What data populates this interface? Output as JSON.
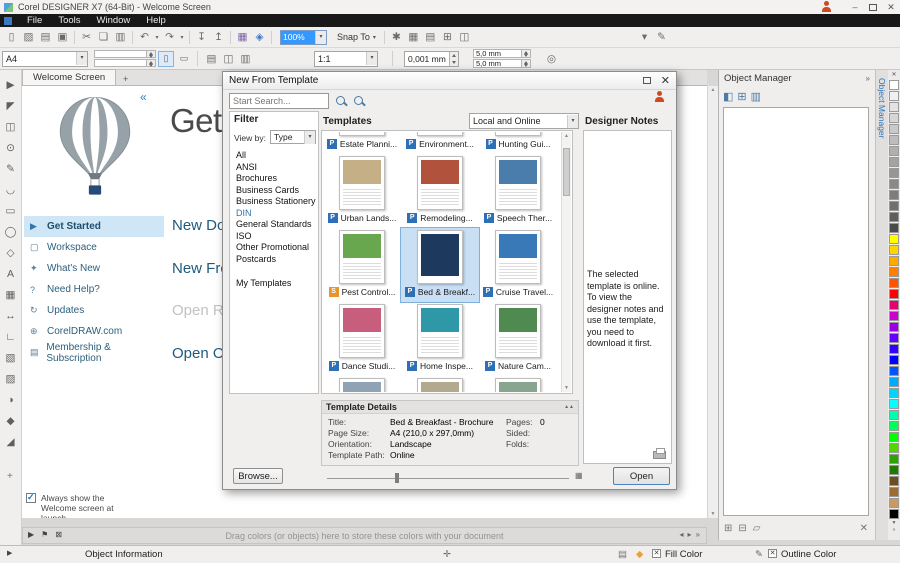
{
  "window": {
    "title": "Corel DESIGNER X7 (64-Bit) - Welcome Screen"
  },
  "icons": {
    "minimize": "–",
    "close": "✕",
    "dropdown": "▾",
    "scroll_up": "▲",
    "scroll_down": "▼",
    "chevrons_right": "»",
    "collapse_left": "«",
    "plus": "+",
    "collapse_up": "▲▲",
    "pal_down": "▼",
    "pal_more": "»"
  },
  "menubar": {
    "items": [
      {
        "label": "File"
      },
      {
        "label": "Tools"
      },
      {
        "label": "Window"
      },
      {
        "label": "Help"
      }
    ]
  },
  "toolbar": {
    "zoom_value": "100%",
    "snap_label": "Snap To",
    "left_icons": [
      {
        "name": "new-document-icon",
        "glyph": "▯"
      },
      {
        "name": "open-icon",
        "glyph": "▨"
      },
      {
        "name": "save-icon",
        "glyph": "▤"
      },
      {
        "name": "print-icon",
        "glyph": "▣"
      },
      {
        "sep": true,
        "interactable": "false"
      },
      {
        "name": "cut-icon",
        "glyph": "✂"
      },
      {
        "name": "copy-icon",
        "glyph": "❏"
      },
      {
        "name": "paste-icon",
        "glyph": "▥"
      },
      {
        "sep": true,
        "interactable": "false"
      },
      {
        "name": "undo-icon",
        "glyph": "↶"
      },
      {
        "name": "undo-dropdown-icon",
        "glyph": "▾",
        "small": true
      },
      {
        "name": "redo-icon",
        "glyph": "↷"
      },
      {
        "name": "redo-dropdown-icon",
        "glyph": "▾",
        "small": true
      },
      {
        "sep": true,
        "interactable": "false"
      },
      {
        "name": "import-icon",
        "glyph": "↧"
      },
      {
        "name": "export-icon",
        "glyph": "↥"
      },
      {
        "sep": true,
        "interactable": "false"
      },
      {
        "name": "application-launcher-icon",
        "glyph": "▦",
        "color": "#7b5ea7"
      },
      {
        "name": "welcome-screen-icon",
        "glyph": "◈",
        "color": "#3b78c3"
      },
      {
        "sep": true,
        "interactable": "false"
      }
    ],
    "right_icons": [
      {
        "sep": true,
        "interactable": "false"
      },
      {
        "name": "options-icon",
        "glyph": "✱"
      },
      {
        "name": "snap-settings-icon",
        "glyph": "▦"
      },
      {
        "name": "guidelines-icon",
        "glyph": "▤"
      },
      {
        "name": "grid-icon",
        "glyph": "⊞"
      },
      {
        "name": "rulers-icon",
        "glyph": "◫"
      }
    ],
    "far_icons": [
      {
        "name": "toolbar-overflow-icon",
        "glyph": "▾"
      },
      {
        "name": "customize-icon",
        "glyph": "✎"
      }
    ]
  },
  "propbar": {
    "page_size": "A4",
    "portrait": "▯",
    "landscape": "▭",
    "ratio": "1:1",
    "nudge": "0,001 mm",
    "dup_x": "5,0 mm",
    "dup_y": "5,0 mm",
    "icons": [
      {
        "name": "units-icon",
        "glyph": "▤"
      },
      {
        "name": "page-settings-icon",
        "glyph": "◫"
      },
      {
        "name": "drawing-units-icon",
        "glyph": "▥"
      }
    ],
    "trailing_icon": "◎"
  },
  "tabbar": {
    "welcome_tab": "Welcome Screen"
  },
  "toolbox": {
    "tools": [
      {
        "name": "pick-tool",
        "glyph": "▶"
      },
      {
        "name": "shape-tool",
        "glyph": "◤"
      },
      {
        "name": "crop-tool",
        "glyph": "◫"
      },
      {
        "name": "zoom-tool",
        "glyph": "⊙"
      },
      {
        "name": "freehand-tool",
        "glyph": "✎"
      },
      {
        "name": "curve-tool",
        "glyph": "◡"
      },
      {
        "name": "rectangle-tool",
        "glyph": "▭"
      },
      {
        "name": "ellipse-tool",
        "glyph": "◯"
      },
      {
        "name": "polygon-tool",
        "glyph": "◇"
      },
      {
        "name": "text-tool",
        "glyph": "A"
      },
      {
        "name": "table-tool",
        "glyph": "▦"
      },
      {
        "name": "dimension-tool",
        "glyph": "↔"
      },
      {
        "name": "connector-tool",
        "glyph": "∟"
      },
      {
        "name": "drop-shadow-tool",
        "glyph": "▧"
      },
      {
        "name": "transparency-tool",
        "glyph": "▨"
      },
      {
        "name": "eyedropper-tool",
        "glyph": "◑"
      },
      {
        "name": "outline-tool",
        "glyph": "◆"
      },
      {
        "name": "fill-tool",
        "glyph": "◢"
      }
    ],
    "expand": "+"
  },
  "welcome": {
    "sidebar": [
      {
        "label": "Get Started",
        "glyph": "▶",
        "icon_name": "get-started-icon",
        "icon_color": "#2e74b5",
        "active": true
      },
      {
        "label": "Workspace",
        "glyph": "▢",
        "icon_name": "workspace-icon",
        "icon_color": "#5b7e95"
      },
      {
        "label": "What's New",
        "glyph": "✦",
        "icon_name": "whats-new-icon",
        "icon_color": "#5b7e95"
      },
      {
        "label": "Need Help?",
        "glyph": "?",
        "icon_name": "need-help-icon",
        "icon_color": "#5b7e95"
      },
      {
        "label": "Updates",
        "glyph": "↻",
        "icon_name": "updates-icon",
        "icon_color": "#5b7e95"
      },
      {
        "label": "CorelDRAW.com",
        "glyph": "⊕",
        "icon_name": "coreldraw-com-icon",
        "icon_color": "#5b7e95"
      },
      {
        "label": "Membership & Subscription",
        "glyph": "▤",
        "icon_name": "membership-icon",
        "icon_color": "#5b7e95"
      }
    ],
    "headings": {
      "main": "Get",
      "new_document": "New Doc",
      "new_from_template": "New Fro",
      "open_recent": "Open Rec",
      "open_other": "Open Oth"
    },
    "launch_checkbox": {
      "checked": true,
      "label": "Always show the Welcome screen at launch."
    }
  },
  "dialog": {
    "title": "New From Template",
    "search": {
      "placeholder": "Start Search..."
    },
    "filter": {
      "header": "Filter",
      "view_by_label": "View by:",
      "view_by_value": "Type",
      "items": [
        {
          "label": "All"
        },
        {
          "label": "ANSI"
        },
        {
          "label": "Brochures"
        },
        {
          "label": "Business Cards"
        },
        {
          "label": "Business Stationery"
        },
        {
          "label": "DIN",
          "highlight": true
        },
        {
          "label": "General Standards"
        },
        {
          "label": "ISO"
        },
        {
          "label": "Other Promotional"
        },
        {
          "label": "Postcards"
        }
      ],
      "my_templates_label": "My Templates"
    },
    "templates": {
      "header": "Templates",
      "source_value": "Local and Online",
      "items": [
        {
          "name": "Estate Planni...",
          "badge": "P",
          "badge_color": "#2f6fb5",
          "accent": "#a8b0b8"
        },
        {
          "name": "Environment...",
          "badge": "P",
          "badge_color": "#2f6fb5",
          "accent": "#6f9f5f"
        },
        {
          "name": "Hunting Gui...",
          "badge": "P",
          "badge_color": "#2f6fb5",
          "accent": "#7d6f52"
        },
        {
          "name": "Urban Lands...",
          "badge": "P",
          "badge_color": "#2f6fb5",
          "accent": "#c4af86"
        },
        {
          "name": "Remodeling...",
          "badge": "P",
          "badge_color": "#2f6fb5",
          "accent": "#b0523c"
        },
        {
          "name": "Speech Ther...",
          "badge": "P",
          "badge_color": "#2f6fb5",
          "accent": "#4a7dab"
        },
        {
          "name": "Pest Control...",
          "badge": "S",
          "badge_color": "#e6952f",
          "accent": "#69a74e"
        },
        {
          "name": "Bed & Breakf...",
          "badge": "P",
          "badge_color": "#2f6fb5",
          "accent": "#1d3a5e",
          "selected": true
        },
        {
          "name": "Cruise Travel...",
          "badge": "P",
          "badge_color": "#2f6fb5",
          "accent": "#3a79b8"
        },
        {
          "name": "Dance Studi...",
          "badge": "P",
          "badge_color": "#2f6fb5",
          "accent": "#c75e7e"
        },
        {
          "name": "Home Inspe...",
          "badge": "P",
          "badge_color": "#2f6fb5",
          "accent": "#2f98a8"
        },
        {
          "name": "Nature Cam...",
          "badge": "P",
          "badge_color": "#2f6fb5",
          "accent": "#4f8a50"
        },
        {
          "name": "",
          "badge": "",
          "accent": "#8fa3b5"
        },
        {
          "name": "",
          "badge": "",
          "accent": "#b3a98f"
        },
        {
          "name": "",
          "badge": "",
          "accent": "#88a58f"
        }
      ]
    },
    "designer_notes": {
      "header": "Designer Notes",
      "text": "The selected template is online. To view the designer notes and use the template, you need to download it first."
    },
    "details": {
      "header": "Template Details",
      "fields": [
        {
          "label": "Title:",
          "value": "Bed & Breakfast - Brochure"
        },
        {
          "label": "Page Size:",
          "value": "A4 (210,0 x 297,0mm)"
        },
        {
          "label": "Orientation:",
          "value": "Landscape"
        },
        {
          "label": "Template Path:",
          "value": "Online"
        }
      ],
      "fields_right": [
        {
          "label": "Pages:",
          "value": "0"
        },
        {
          "label": "Sided:",
          "value": ""
        },
        {
          "label": "Folds:",
          "value": ""
        }
      ]
    },
    "browse_button": "Browse...",
    "open_button": "Open"
  },
  "docker": {
    "title": "Object Manager",
    "tab_label": "Object Manager",
    "toolbar_icons": [
      {
        "name": "object-properties-icon",
        "glyph": "◧"
      },
      {
        "name": "edit-across-layers-icon",
        "glyph": "⊞"
      },
      {
        "name": "layer-manager-view-icon",
        "glyph": "▥"
      }
    ],
    "bottom_icons": [
      {
        "name": "new-layer-icon",
        "glyph": "⊞"
      },
      {
        "name": "new-master-layer-icon",
        "glyph": "⊟"
      },
      {
        "name": "new-object-icon",
        "glyph": "▱"
      }
    ],
    "delete_icon": "✕"
  },
  "palette": {
    "colors": [
      "#ffffff",
      "#f0f0f0",
      "#e3e3e3",
      "#d6d6d6",
      "#c9c9c9",
      "#bdbdbd",
      "#b0b0b0",
      "#a3a3a3",
      "#969696",
      "#898989",
      "#7d7d7d",
      "#707070",
      "#5e5e5e",
      "#4a4a4a",
      "#ffff00",
      "#ffd400",
      "#ffaa00",
      "#ff7f00",
      "#ff5500",
      "#ff0000",
      "#e60073",
      "#cc00cc",
      "#9900e6",
      "#6600ff",
      "#3300ff",
      "#0000ff",
      "#0055ff",
      "#00aaff",
      "#00d4ff",
      "#00ffff",
      "#00ffaa",
      "#00ff55",
      "#00ff00",
      "#55d400",
      "#2da300",
      "#1e7a00",
      "#6b4f1e",
      "#9b6b32",
      "#c89a64",
      "#000000"
    ]
  },
  "hintbar": {
    "text": "Drag colors (or objects) here to store these colors with your document",
    "left_icons": [
      {
        "name": "page-flyout-icon",
        "glyph": "▶"
      },
      {
        "name": "flag-icon",
        "glyph": "⚑"
      },
      {
        "name": "no-color-icon",
        "glyph": "⊠"
      }
    ],
    "right_icons": [
      {
        "name": "scroll-left-icon",
        "glyph": "◂"
      },
      {
        "name": "scroll-right-icon",
        "glyph": "▸"
      },
      {
        "name": "palette-more-icon",
        "glyph": "»"
      }
    ]
  },
  "statusbar": {
    "flyout_glyph": "▶",
    "object_info": "Object Information",
    "cursor_glyph": "✛",
    "page_glyph": "▤",
    "diamond_glyph": "◆",
    "none_glyph": "✕",
    "pen_glyph": "✎",
    "fill_label": "Fill Color",
    "outline_label": "Outline Color"
  }
}
